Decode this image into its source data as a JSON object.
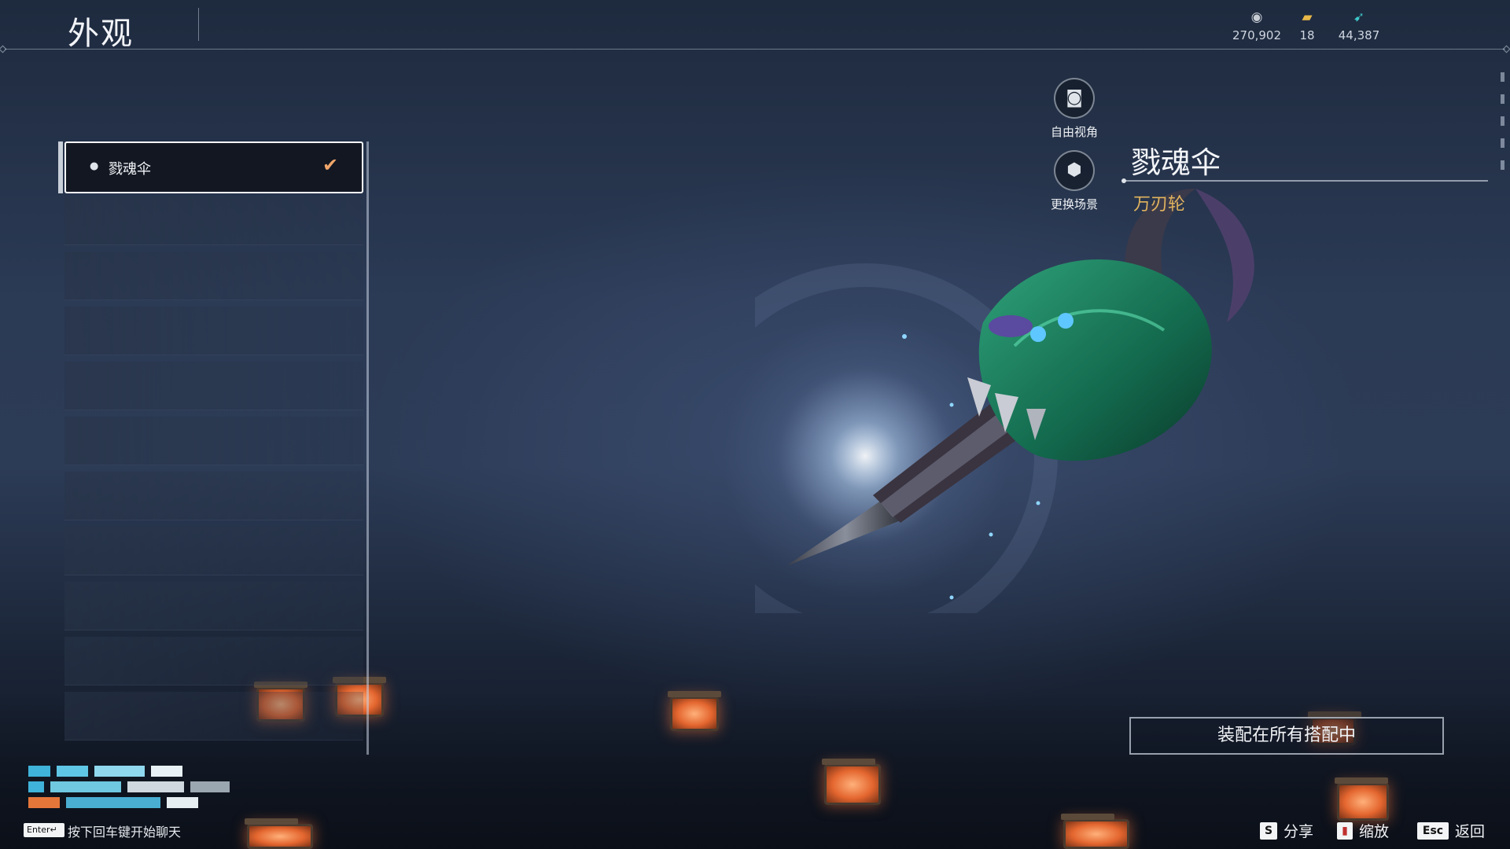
{
  "header": {
    "title": "外观",
    "currencies": [
      {
        "icon": "coin-stack-icon",
        "value": "270,902"
      },
      {
        "icon": "ticket-icon",
        "value": "18"
      },
      {
        "icon": "feather-icon",
        "value": "44,387"
      }
    ]
  },
  "list": {
    "items": [
      {
        "label": "戮魂伞",
        "selected": true
      }
    ]
  },
  "side_buttons": {
    "free_camera": "自由视角",
    "change_scene": "更换场景"
  },
  "item": {
    "name": "戮魂伞",
    "subtitle": "万刃轮"
  },
  "equip_button": "装配在所有搭配中",
  "chat": {
    "enter_key": "Enter↵",
    "hint": "按下回车键开始聊天"
  },
  "footer": {
    "share_key": "S",
    "share_label": "分享",
    "zoom_label": "缩放",
    "back_key": "Esc",
    "back_label": "返回"
  },
  "colors": {
    "accent_orange": "#e0b35e",
    "check_orange": "#f0a66a",
    "panel_dark": "#121722"
  }
}
